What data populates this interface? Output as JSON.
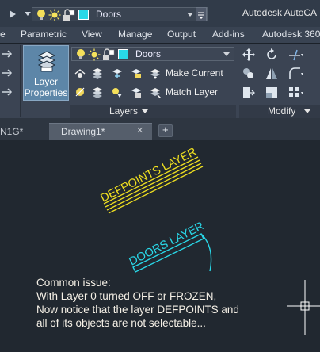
{
  "titlebar": {
    "layer_name": "Doors",
    "app_title": "Autodesk AutoCA"
  },
  "ribbon_tabs": [
    "e",
    "Parametric",
    "View",
    "Manage",
    "Output",
    "Add-ins",
    "Autodesk 360"
  ],
  "ribbon": {
    "layer_properties_label_1": "Layer",
    "layer_properties_label_2": "Properties",
    "layer_combo_value": "Doors",
    "make_current_label": "Make Current",
    "match_layer_label": "Match Layer",
    "layers_panel_title": "Layers",
    "modify_panel_title": "Modify"
  },
  "doc_tabs": {
    "inactive_tab": "N1G*",
    "active_tab": "Drawing1*",
    "close_glyph": "✕",
    "plus_glyph": "+"
  },
  "drawing": {
    "defpoints_label": "DEFPOINTS LAYER",
    "doors_label": "DOORS LAYER",
    "note_lines": [
      "Common issue:",
      "With Layer 0 turned OFF or FROZEN,",
      "Now notice that the layer DEFPOINTS and",
      "all of its objects are not selectable..."
    ]
  },
  "colors": {
    "defpoints": "#f0e020",
    "doors": "#29d8e8",
    "layer_swatch": "#29d8e8",
    "canvas_bg": "#212830"
  }
}
